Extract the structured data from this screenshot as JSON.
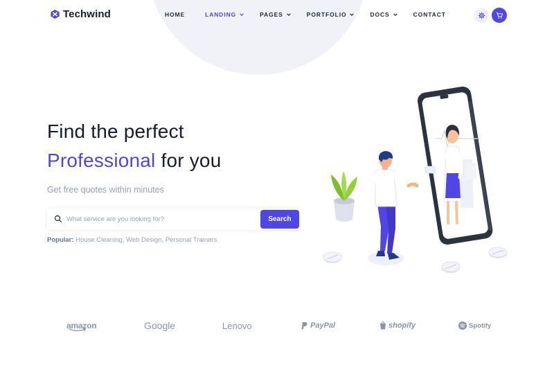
{
  "brand": {
    "name": "Techwind"
  },
  "nav": {
    "items": [
      {
        "label": "HOME",
        "dropdown": false,
        "active": false
      },
      {
        "label": "LANDING",
        "dropdown": true,
        "active": true
      },
      {
        "label": "PAGES",
        "dropdown": true,
        "active": false
      },
      {
        "label": "PORTFOLIO",
        "dropdown": true,
        "active": false
      },
      {
        "label": "DOCS",
        "dropdown": true,
        "active": false
      },
      {
        "label": "CONTACT",
        "dropdown": false,
        "active": false
      }
    ],
    "settings_icon": "gear-icon",
    "cart_icon": "cart-icon"
  },
  "hero": {
    "title_line1": "Find the perfect",
    "title_accent": "Professional",
    "title_rest": " for you",
    "subtitle": "Get free quotes within minutes"
  },
  "search": {
    "placeholder": "What service are you looking for?",
    "value": "",
    "button_label": "Search"
  },
  "popular": {
    "label": "Popular:",
    "items": "House Cleaning, Web Design, Personal Trainers"
  },
  "brands": [
    "amazon",
    "Google",
    "Lenovo",
    "PayPal",
    "shopify",
    "Spotify"
  ],
  "colors": {
    "accent": "#4f46e5",
    "text_dark": "#161c2d",
    "muted": "#94a3b8",
    "brand_gray": "#8b95a5"
  }
}
